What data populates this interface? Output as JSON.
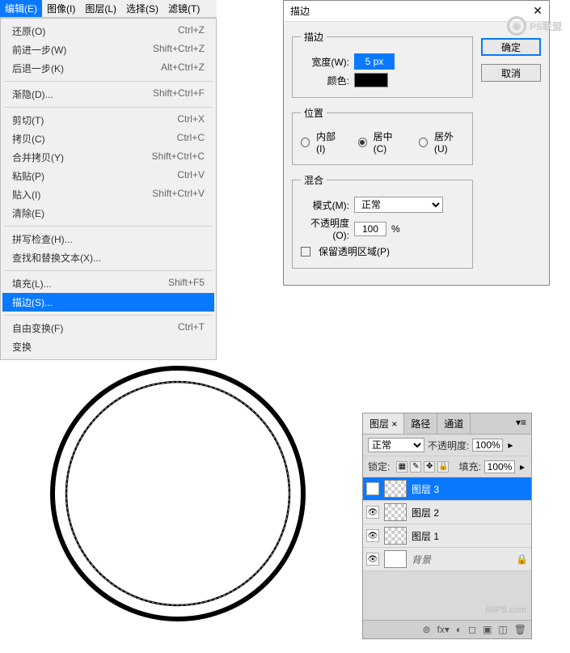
{
  "menubar": {
    "items": [
      "编辑(E)",
      "图像(I)",
      "图层(L)",
      "选择(S)",
      "滤镜(T)"
    ],
    "active": "编辑(E)"
  },
  "edit_menu": {
    "groups": [
      [
        {
          "label": "还原(O)",
          "shortcut": "Ctrl+Z"
        },
        {
          "label": "前进一步(W)",
          "shortcut": "Shift+Ctrl+Z"
        },
        {
          "label": "后退一步(K)",
          "shortcut": "Alt+Ctrl+Z"
        }
      ],
      [
        {
          "label": "渐隐(D)...",
          "shortcut": "Shift+Ctrl+F"
        }
      ],
      [
        {
          "label": "剪切(T)",
          "shortcut": "Ctrl+X"
        },
        {
          "label": "拷贝(C)",
          "shortcut": "Ctrl+C"
        },
        {
          "label": "合并拷贝(Y)",
          "shortcut": "Shift+Ctrl+C"
        },
        {
          "label": "粘贴(P)",
          "shortcut": "Ctrl+V"
        },
        {
          "label": "贴入(I)",
          "shortcut": "Shift+Ctrl+V"
        },
        {
          "label": "清除(E)",
          "shortcut": ""
        }
      ],
      [
        {
          "label": "拼写检查(H)...",
          "shortcut": ""
        },
        {
          "label": "查找和替换文本(X)...",
          "shortcut": ""
        }
      ],
      [
        {
          "label": "填充(L)...",
          "shortcut": "Shift+F5"
        },
        {
          "label": "描边(S)...",
          "shortcut": "",
          "highlight": true
        }
      ],
      [
        {
          "label": "自由变换(F)",
          "shortcut": "Ctrl+T"
        },
        {
          "label": "变换",
          "shortcut": ""
        }
      ]
    ]
  },
  "dialog": {
    "title": "描边",
    "ok": "确定",
    "cancel": "取消",
    "stroke": {
      "legend": "描边",
      "width_label": "宽度(W):",
      "width_value": "5 px",
      "color_label": "颜色:"
    },
    "position": {
      "legend": "位置",
      "inside": "内部(I)",
      "center": "居中(C)",
      "outside": "居外(U)",
      "selected": "center"
    },
    "blend": {
      "legend": "混合",
      "mode_label": "模式(M):",
      "mode_value": "正常",
      "opacity_label": "不透明度(O):",
      "opacity_value": "100",
      "opacity_unit": "%",
      "preserve": "保留透明区域(P)"
    }
  },
  "layers": {
    "tabs": [
      "图层 ×",
      "路径",
      "通道"
    ],
    "active_tab": 0,
    "blend_mode": "正常",
    "opacity_label": "不透明度:",
    "opacity_value": "100%",
    "lock_label": "锁定:",
    "fill_label": "填充:",
    "fill_value": "100%",
    "items": [
      {
        "visible": true,
        "thumb": "checker",
        "name": "图层 3",
        "selected": true
      },
      {
        "visible": true,
        "thumb": "checker",
        "name": "图层 2"
      },
      {
        "visible": true,
        "thumb": "checker",
        "name": "图层 1"
      },
      {
        "visible": true,
        "thumb": "solid",
        "name": "背景",
        "italic": true,
        "locked": true
      }
    ],
    "footer": [
      "⊚",
      "fx▾",
      "◐",
      "◻",
      "▣",
      "◫",
      "🗑"
    ],
    "watermark": "68PS.com"
  },
  "watermark": {
    "brand": "PS联盟",
    "url": "68PS.com"
  }
}
